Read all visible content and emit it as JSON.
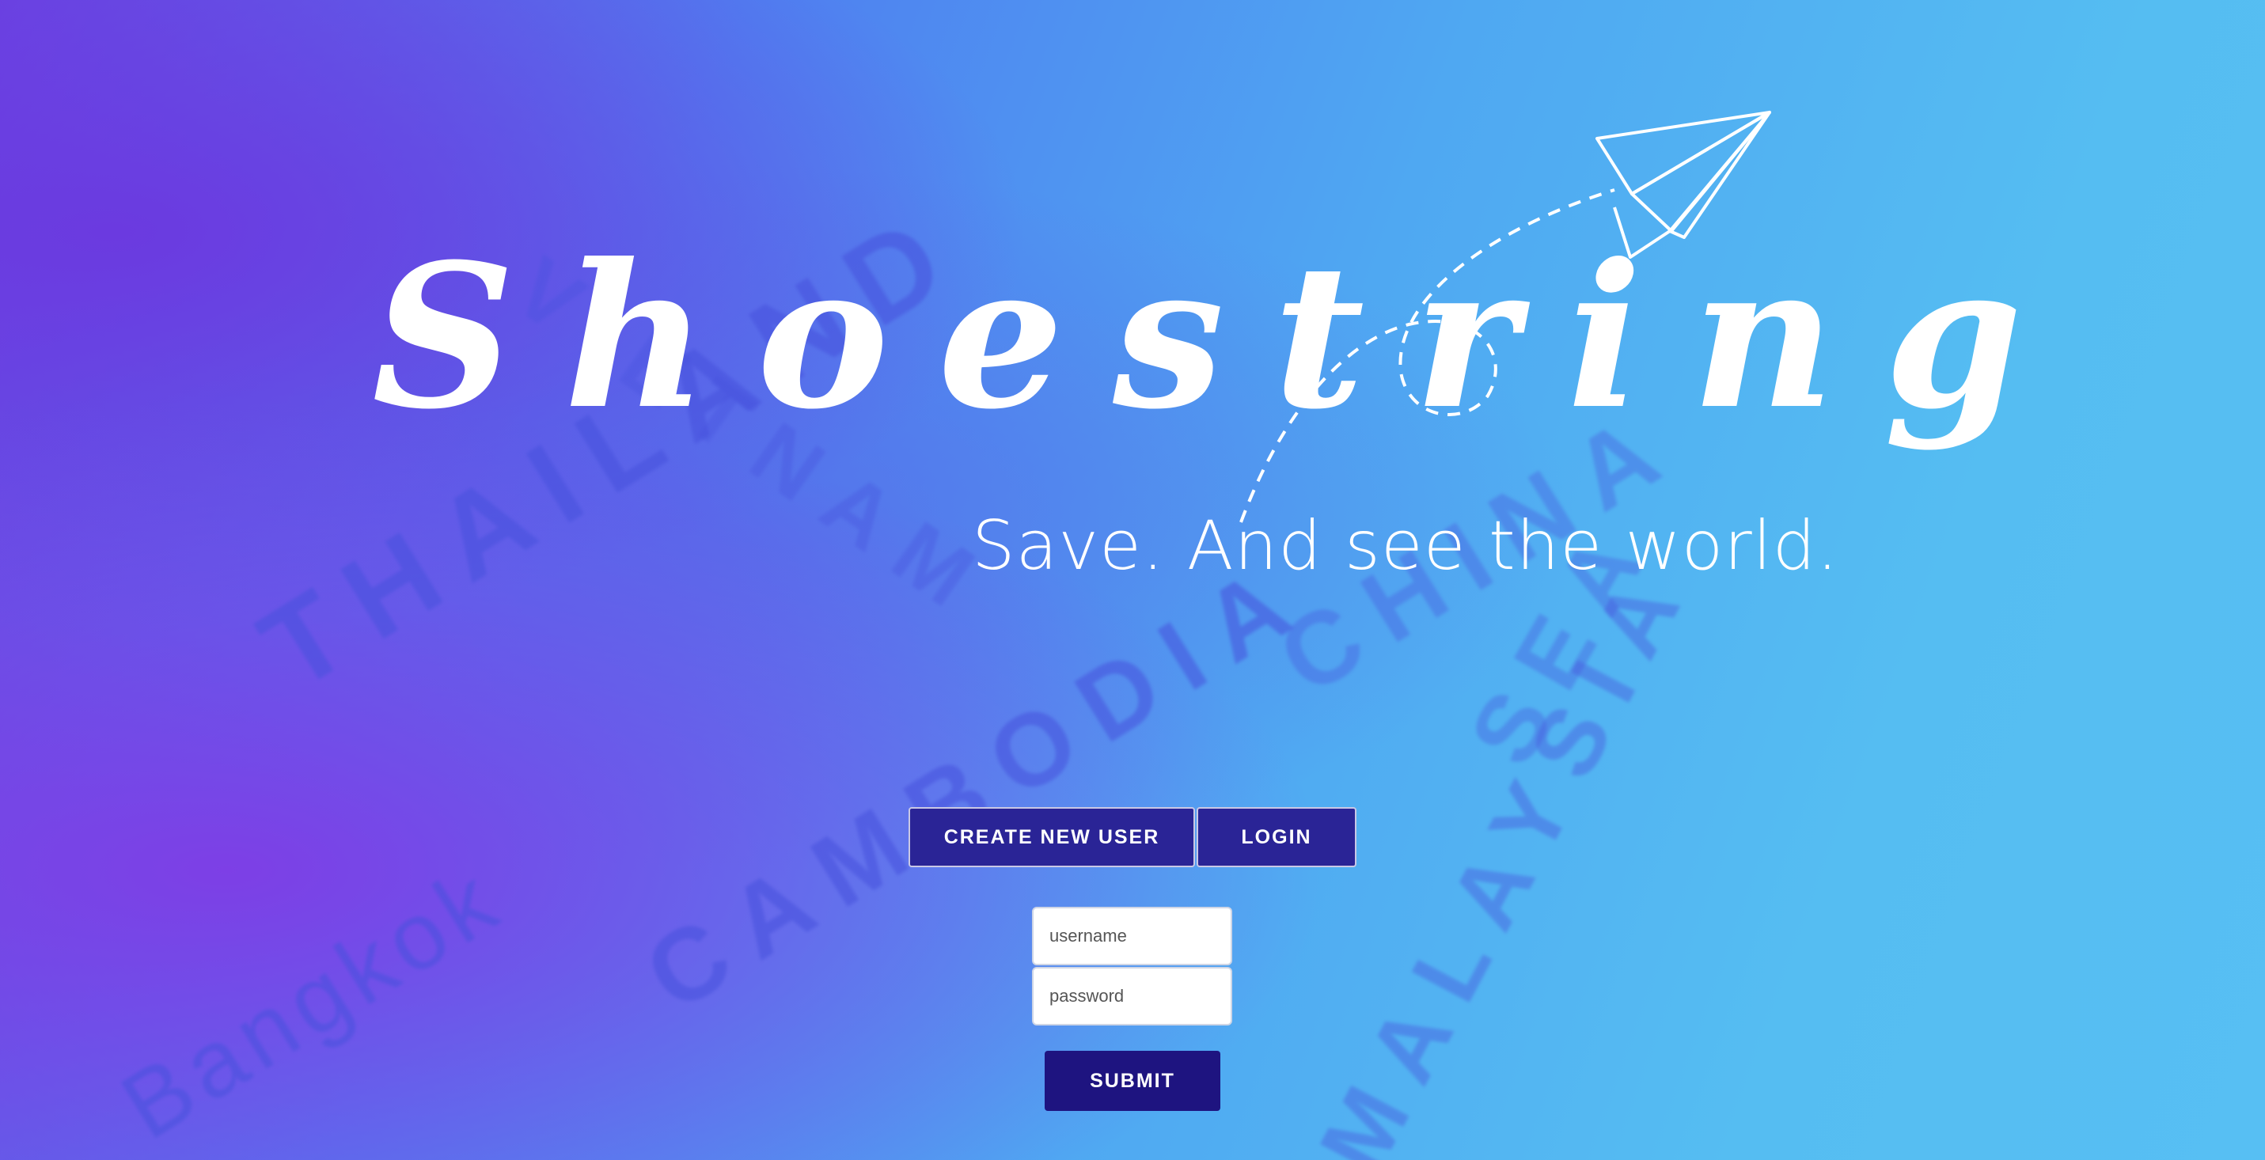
{
  "branding": {
    "logo_text": "Shoestring",
    "tagline": "Save. And see the world."
  },
  "background_map_labels": {
    "country_1": "THAILAND",
    "country_2": "CAMBODIA",
    "country_3": "MALAYSIA",
    "country_4": "VIETNAM",
    "sea": "SEA",
    "city": "Bangkok",
    "country_5": "CHINA"
  },
  "auth_tabs": {
    "create_label": "CREATE NEW USER",
    "login_label": "LOGIN"
  },
  "form": {
    "username_placeholder": "username",
    "password_placeholder": "password",
    "submit_label": "SUBMIT"
  },
  "colors": {
    "button_bg": "#2a2496",
    "submit_bg": "#1e1480",
    "accent_blue": "#55bdf2",
    "accent_purple": "#7d3fe6"
  }
}
